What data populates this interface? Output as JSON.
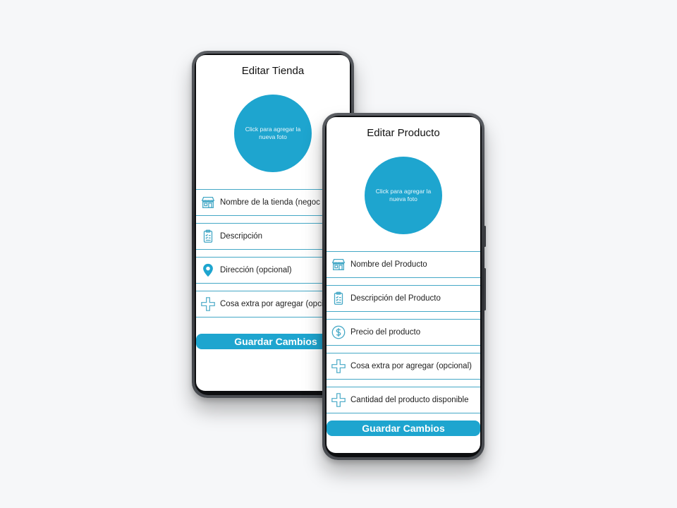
{
  "tienda": {
    "title": "Editar Tienda",
    "photo_hint": "Click para agregar la nueva foto",
    "fields": [
      {
        "label": "Nombre de la tienda (negoc",
        "icon": "store-icon"
      },
      {
        "label": "Descripción",
        "icon": "clipboard-icon"
      },
      {
        "label": "Dirección (opcional)",
        "icon": "location-pin-icon"
      },
      {
        "label": "Cosa extra por agregar (opci",
        "icon": "plus-icon"
      }
    ],
    "save_label": "Guardar Cambios"
  },
  "producto": {
    "title": "Editar Producto",
    "photo_hint": "Click para agregar la nueva foto",
    "fields": [
      {
        "label": "Nombre del Producto",
        "icon": "store-icon"
      },
      {
        "label": "Descripción del Producto",
        "icon": "clipboard-icon"
      },
      {
        "label": "Precio del producto",
        "icon": "dollar-icon"
      },
      {
        "label": "Cosa extra por agregar (opcional)",
        "icon": "plus-icon"
      },
      {
        "label": "Cantidad del producto disponible",
        "icon": "plus-icon"
      }
    ],
    "save_label": "Guardar Cambios"
  },
  "colors": {
    "accent": "#1ea5cf",
    "divider": "#45a8c6"
  }
}
